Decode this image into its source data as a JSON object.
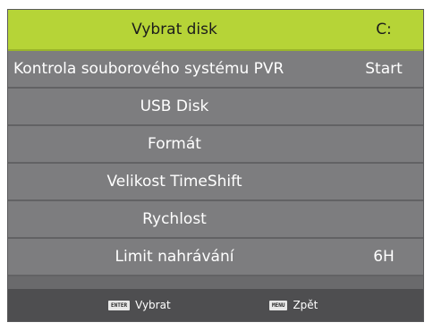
{
  "menu": {
    "items": [
      {
        "label": "Vybrat disk",
        "value": "C:"
      },
      {
        "label": "Kontrola souborového systému PVR",
        "value": "Start"
      },
      {
        "label": "USB Disk",
        "value": ""
      },
      {
        "label": "Formát",
        "value": ""
      },
      {
        "label": "Velikost TimeShift",
        "value": ""
      },
      {
        "label": "Rychlost",
        "value": ""
      },
      {
        "label": "Limit nahrávání",
        "value": "6H"
      }
    ],
    "selected_index": 0
  },
  "footer": {
    "enter_key": "ENTER",
    "enter_label": "Vybrat",
    "menu_key": "MENU",
    "menu_label": "Zpět"
  },
  "colors": {
    "highlight": "#b6d437",
    "row_bg": "#7d7d7f",
    "footer_bg": "#4e4e50"
  }
}
